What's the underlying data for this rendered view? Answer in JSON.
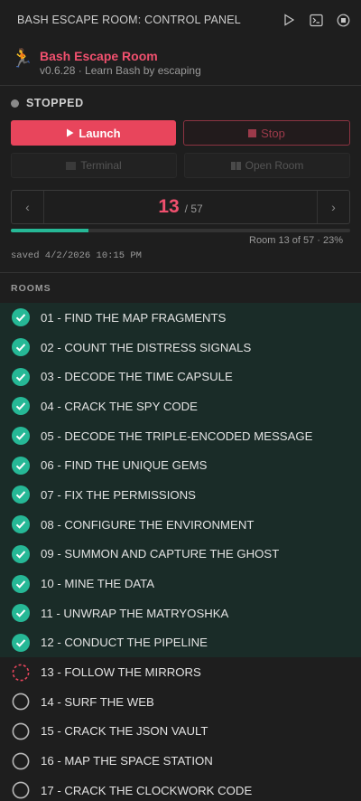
{
  "titlebar": {
    "title": "BASH ESCAPE ROOM: CONTROL PANEL"
  },
  "app": {
    "logo": "🏃",
    "name": "Bash Escape Room",
    "subtitle": "v0.6.28 · Learn Bash by escaping"
  },
  "status": {
    "text": "STOPPED",
    "color": "#8a8a8a"
  },
  "buttons": {
    "launch": "Launch",
    "stop": "Stop",
    "terminal": "Terminal",
    "open_room": "Open Room"
  },
  "nav": {
    "current": "13",
    "total": "/ 57"
  },
  "progress": {
    "fraction": 0.23,
    "label": "Room 13 of 57 · 23%"
  },
  "saved": "saved 4/2/2026 10:15 PM",
  "rooms_heading": "ROOMS",
  "colors": {
    "accent": "#e8455c",
    "done": "#26b896"
  },
  "rooms": [
    {
      "label": "01 - FIND THE MAP FRAGMENTS",
      "state": "done"
    },
    {
      "label": "02 - COUNT THE DISTRESS SIGNALS",
      "state": "done"
    },
    {
      "label": "03 - DECODE THE TIME CAPSULE",
      "state": "done"
    },
    {
      "label": "04 - CRACK THE SPY CODE",
      "state": "done"
    },
    {
      "label": "05 - DECODE THE TRIPLE-ENCODED MESSAGE",
      "state": "done"
    },
    {
      "label": "06 - FIND THE UNIQUE GEMS",
      "state": "done"
    },
    {
      "label": "07 - FIX THE PERMISSIONS",
      "state": "done"
    },
    {
      "label": "08 - CONFIGURE THE ENVIRONMENT",
      "state": "done"
    },
    {
      "label": "09 - SUMMON AND CAPTURE THE GHOST",
      "state": "done"
    },
    {
      "label": "10 - MINE THE DATA",
      "state": "done"
    },
    {
      "label": "11 - UNWRAP THE MATRYOSHKA",
      "state": "done"
    },
    {
      "label": "12 - CONDUCT THE PIPELINE",
      "state": "done"
    },
    {
      "label": "13 - FOLLOW THE MIRRORS",
      "state": "current"
    },
    {
      "label": "14 - SURF THE WEB",
      "state": "todo"
    },
    {
      "label": "15 - CRACK THE JSON VAULT",
      "state": "todo"
    },
    {
      "label": "16 - MAP THE SPACE STATION",
      "state": "todo"
    },
    {
      "label": "17 - CRACK THE CLOCKWORK CODE",
      "state": "todo"
    }
  ]
}
